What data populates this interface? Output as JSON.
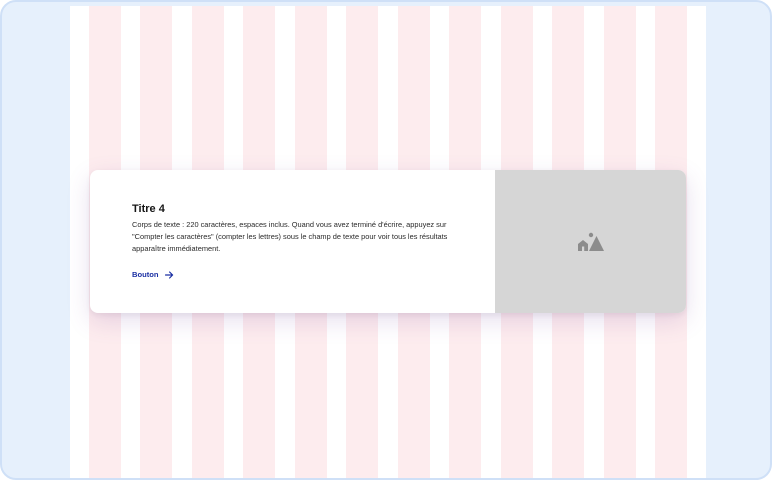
{
  "card": {
    "title": "Titre 4",
    "body": "Corps de texte : 220 caractères, espaces inclus. Quand vous avez terminé d'écrire, appuyez sur \"Compter les caractères\" (compter les lettres) sous le champ de texte pour voir tous les résultats apparaître immédiatement.",
    "button_label": "Bouton",
    "button_icon": "arrow-right-icon",
    "media_icon": "image-placeholder-icon"
  },
  "colors": {
    "frame_background": "#e6f0fc",
    "grid_column": "#fdecee",
    "card_background": "#ffffff",
    "media_background": "#d6d6d6",
    "link": "#1a2fa3",
    "title": "#161616"
  }
}
